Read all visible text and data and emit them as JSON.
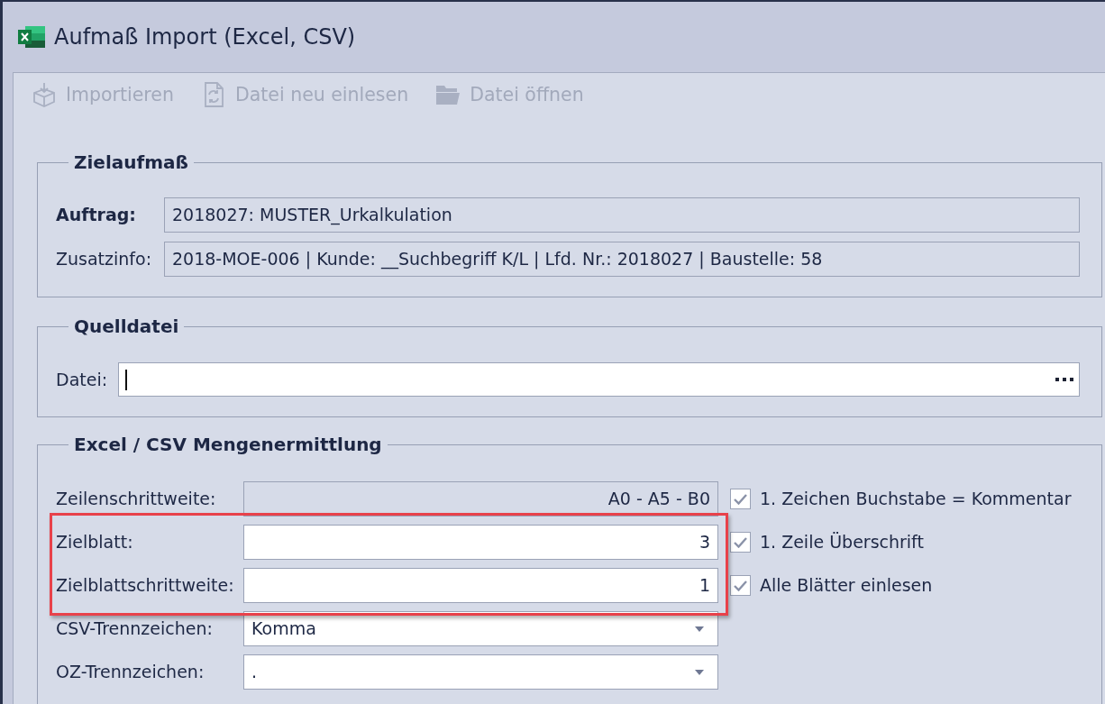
{
  "window": {
    "title": "Aufmaß Import (Excel, CSV)"
  },
  "toolbar": [
    {
      "kind": "import",
      "label": "Importieren",
      "disabled": true
    },
    {
      "kind": "reload",
      "label": "Datei neu einlesen",
      "disabled": true
    },
    {
      "kind": "open",
      "label": "Datei öffnen",
      "disabled": true
    }
  ],
  "target_group": {
    "title": "Zielaufmaß",
    "fields": [
      {
        "label": "Auftrag:",
        "emphasis": true,
        "value": "2018027: MUSTER_Urkalkulation",
        "disabled": true
      },
      {
        "label": "Zusatzinfo:",
        "emphasis": false,
        "value": "2018-MOE-006 | Kunde: __Suchbegriff K/L | Lfd. Nr.: 2018027 | Baustelle: 58",
        "disabled": true
      }
    ]
  },
  "source_group": {
    "title": "Quelldatei",
    "file": {
      "label": "Datei:",
      "focused": true
    }
  },
  "excel_group": {
    "title": "Excel / CSV Mengenermittlung",
    "rows": [
      {
        "label": "Zeilenschrittweite:",
        "kind": "text",
        "value": "A0 - A5 - B0",
        "disabled": true,
        "highlighted": false,
        "checkbox": {
          "label": "1. Zeichen Buchstabe = Kommentar",
          "checked": true
        }
      },
      {
        "label": "Zielblatt:",
        "kind": "text",
        "value": "3",
        "disabled": false,
        "highlighted": true,
        "checkbox": {
          "label": "1. Zeile Überschrift",
          "checked": true
        }
      },
      {
        "label": "Zielblattschrittweite:",
        "kind": "text",
        "value": "1",
        "disabled": false,
        "highlighted": true,
        "checkbox": {
          "label": "Alle Blätter einlesen",
          "checked": true
        }
      },
      {
        "label": "CSV-Trennzeichen:",
        "kind": "dropdown",
        "value": "Komma",
        "disabled": false,
        "highlighted": false
      },
      {
        "label": "OZ-Trennzeichen:",
        "kind": "dropdown",
        "value": ".",
        "disabled": false,
        "highlighted": false
      }
    ]
  }
}
